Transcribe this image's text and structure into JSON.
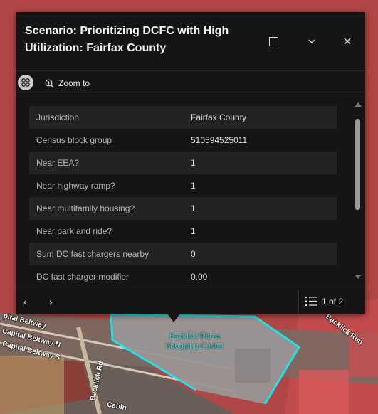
{
  "popup": {
    "title": "Scenario: Prioritizing DCFC with High Utilization: Fairfax County",
    "actions": {
      "zoom_label": "Zoom to"
    },
    "attributes": [
      {
        "key": "Jurisdiction",
        "value": "Fairfax County"
      },
      {
        "key": "Census block group",
        "value": "510594525011"
      },
      {
        "key": "Near EEA?",
        "value": "1"
      },
      {
        "key": "Near highway ramp?",
        "value": "1"
      },
      {
        "key": "Near multifamily housing?",
        "value": "1"
      },
      {
        "key": "Near park and ride?",
        "value": "1"
      },
      {
        "key": "Sum DC fast chargers nearby",
        "value": "0"
      },
      {
        "key": "DC fast charger modifier",
        "value": "0.00"
      }
    ],
    "pager": {
      "prev_label": "‹",
      "next_label": "›",
      "position": "1 of 2"
    }
  },
  "map": {
    "labels": {
      "capital_beltway_n": "Capital Beltway N",
      "capital_beltway_s": "Capital Beltway S",
      "capital_beltway_cut": "pital Beltway",
      "backlick_rd": "Backlick Rd",
      "backlick_run": "Backlick Run",
      "cabin": "Cabin",
      "poi_line1": "Backlick Plaza",
      "poi_line2": "Shopping Center"
    },
    "colors": {
      "overlay_red": "#c03a3a",
      "highlight_cyan": "#22e0e6",
      "panel_bg": "#151515"
    }
  }
}
